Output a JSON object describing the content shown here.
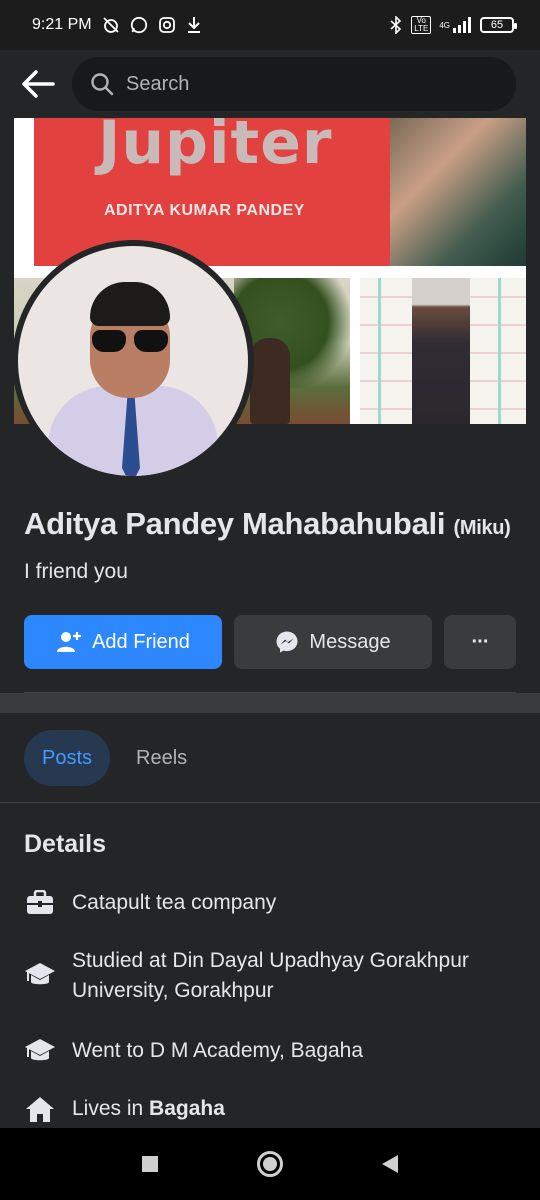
{
  "status_bar": {
    "time": "9:21 PM",
    "network": "4G",
    "battery": "65",
    "volte": "Vo LTE"
  },
  "top_bar": {
    "search_placeholder": "Search"
  },
  "cover": {
    "card_title": "Jupiter",
    "card_name": "ADITYA KUMAR PANDEY"
  },
  "profile": {
    "name": "Aditya Pandey Mahabahubali",
    "nickname": "(Miku)",
    "bio": "I friend you"
  },
  "actions": {
    "add_friend": "Add Friend",
    "message": "Message",
    "more": "···"
  },
  "tabs": [
    {
      "label": "Posts",
      "active": true
    },
    {
      "label": "Reels",
      "active": false
    }
  ],
  "details": {
    "title": "Details",
    "items": [
      {
        "icon": "briefcase-icon",
        "text": "Catapult tea company"
      },
      {
        "icon": "graduation-cap-icon",
        "text": "Studied at Din Dayal Upadhyay Gorakhpur University, Gorakhpur"
      },
      {
        "icon": "graduation-cap-icon",
        "text": "Went to D M Academy, Bagaha"
      },
      {
        "icon": "home-icon",
        "text_prefix": "Lives in ",
        "text_bold": "Bagaha"
      }
    ]
  },
  "colors": {
    "background": "#242526",
    "primary": "#2d88ff",
    "secondary_button": "#3a3b3c",
    "active_tab_bg": "#263951",
    "active_tab_text": "#4599ff"
  }
}
